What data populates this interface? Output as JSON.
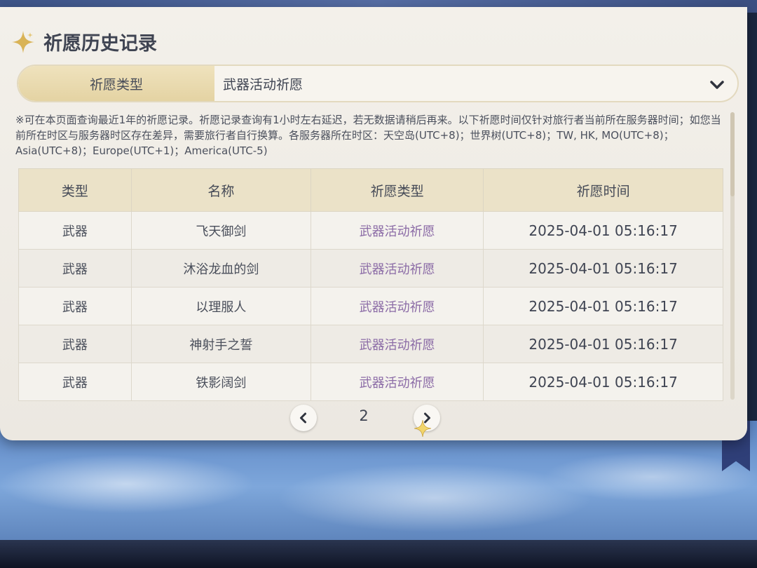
{
  "header": {
    "title": "祈愿历史记录"
  },
  "selector": {
    "label": "祈愿类型",
    "value": "武器活动祈愿"
  },
  "notice": "※可在本页面查询最近1年的祈愿记录。祈愿记录查询有1小时左右延迟，若无数据请稍后再来。以下祈愿时间仅针对旅行者当前所在服务器时间；如您当前所在时区与服务器时区存在差异，需要旅行者自行换算。各服务器所在时区：天空岛(UTC+8)；世界树(UTC+8)；TW, HK, MO(UTC+8)；Asia(UTC+8)；Europe(UTC+1)；America(UTC-5)",
  "table": {
    "headers": [
      "类型",
      "名称",
      "祈愿类型",
      "祈愿时间"
    ],
    "rows": [
      [
        "武器",
        "飞天御剑",
        "武器活动祈愿",
        "2025-04-01 05:16:17"
      ],
      [
        "武器",
        "沐浴龙血的剑",
        "武器活动祈愿",
        "2025-04-01 05:16:17"
      ],
      [
        "武器",
        "以理服人",
        "武器活动祈愿",
        "2025-04-01 05:16:17"
      ],
      [
        "武器",
        "神射手之誓",
        "武器活动祈愿",
        "2025-04-01 05:16:17"
      ],
      [
        "武器",
        "铁影阔剑",
        "武器活动祈愿",
        "2025-04-01 05:16:17"
      ]
    ]
  },
  "pagination": {
    "page": "2"
  },
  "icons": {
    "title": "sparkle-icon",
    "dropdown": "chevron-down-icon",
    "prev": "chevron-left-icon",
    "next": "chevron-right-icon",
    "cursor": "sparkle-cursor-icon"
  },
  "colors": {
    "panel": "#f3f0ea",
    "header_gold": "#ebe2c8",
    "wish_purple": "#8b6ba6",
    "text": "#3f4452"
  }
}
